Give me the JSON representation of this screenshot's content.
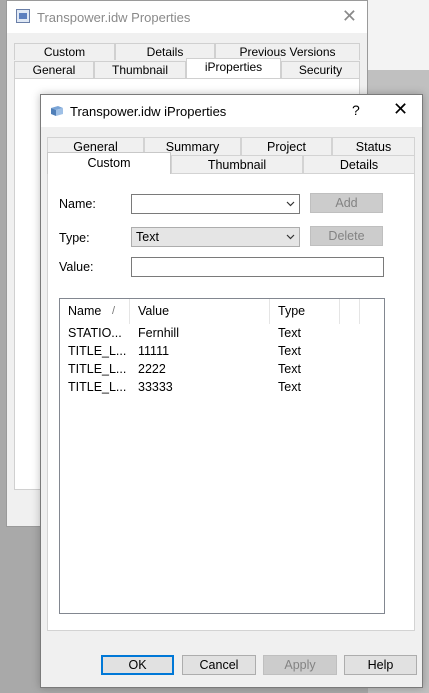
{
  "back_window": {
    "title": "Transpower.idw Properties",
    "tabs_row1": [
      "Custom",
      "Details",
      "Previous Versions"
    ],
    "tabs_row2": [
      "General",
      "Thumbnail",
      "iProperties",
      "Security"
    ]
  },
  "dialog": {
    "title": "Transpower.idw iProperties",
    "help_label": "?",
    "close_label": "✕",
    "tabs_row1": [
      "General",
      "Summary",
      "Project",
      "Status"
    ],
    "tabs_row2": [
      "Custom",
      "Thumbnail",
      "Details"
    ],
    "active_tab": "Custom",
    "form": {
      "name_label": "Name:",
      "name_value": "",
      "type_label": "Type:",
      "type_value": "Text",
      "value_label": "Value:",
      "value_value": "",
      "add_label": "Add",
      "delete_label": "Delete"
    },
    "table": {
      "columns": [
        "Name",
        "Value",
        "Type"
      ],
      "rows": [
        {
          "name": "STATIO...",
          "value": "Fernhill",
          "type": "Text"
        },
        {
          "name": "TITLE_L...",
          "value": "11111",
          "type": "Text"
        },
        {
          "name": "TITLE_L...",
          "value": "2222",
          "type": "Text"
        },
        {
          "name": "TITLE_L...",
          "value": "33333",
          "type": "Text"
        }
      ]
    },
    "buttons": {
      "ok": "OK",
      "cancel": "Cancel",
      "apply": "Apply",
      "help": "Help"
    }
  }
}
